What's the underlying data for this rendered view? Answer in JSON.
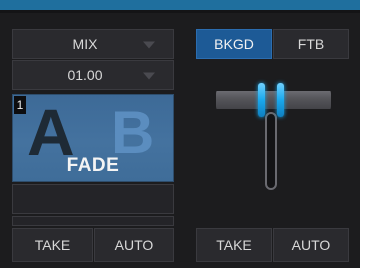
{
  "left": {
    "transition_dropdown": {
      "value": "MIX"
    },
    "duration_dropdown": {
      "value": "01.00"
    },
    "preview": {
      "slot_number": "1",
      "letter_a": "A",
      "letter_b": "B",
      "title": "FADE"
    },
    "take_label": "TAKE",
    "auto_label": "AUTO"
  },
  "right": {
    "bkgd_label": "BKGD",
    "ftb_label": "FTB",
    "take_label": "TAKE",
    "auto_label": "AUTO"
  },
  "colors": {
    "accent": "#1d5a96",
    "tbar_grip": "#1aa8ec",
    "topbar": "#1f6f9e"
  }
}
